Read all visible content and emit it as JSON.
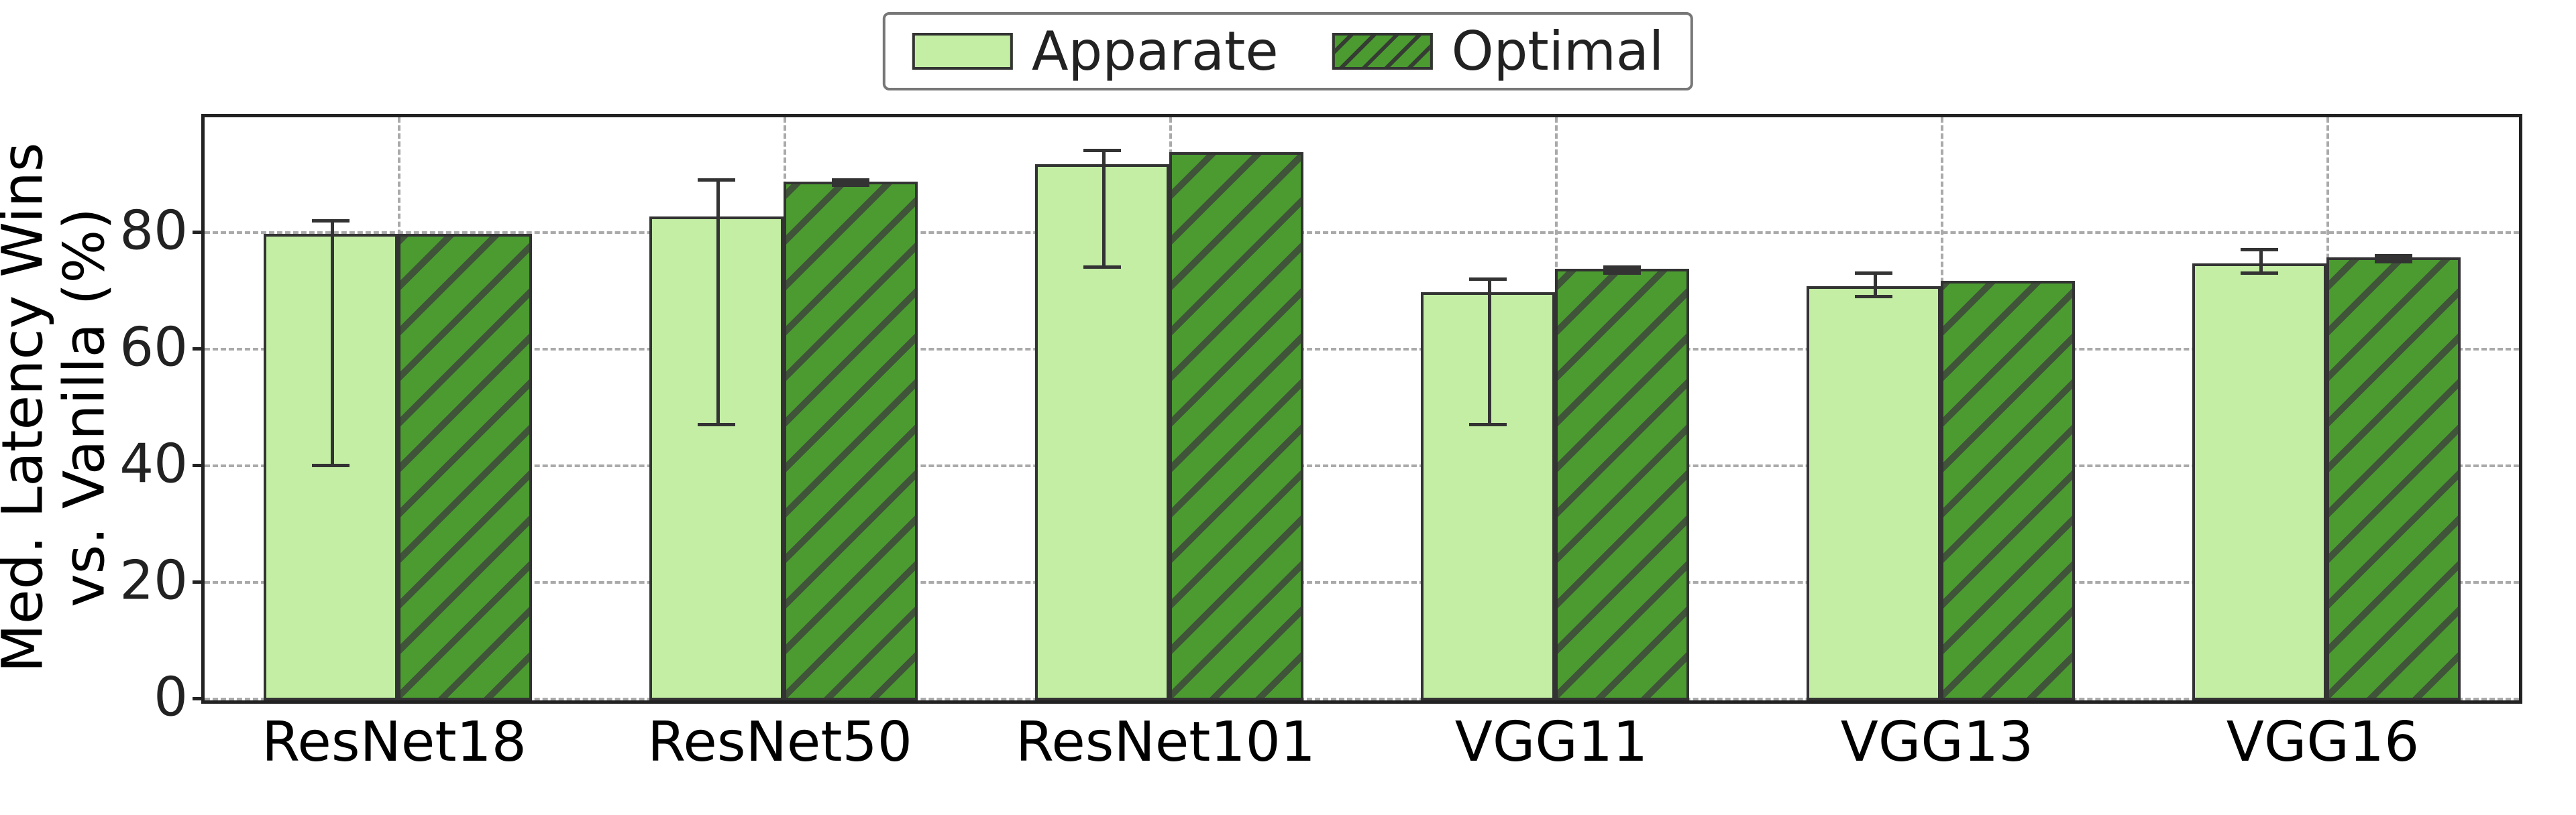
{
  "chart_data": {
    "type": "bar",
    "title": "",
    "xlabel": "",
    "ylabel": "Med. Latency Wins\nvs. Vanilla (%)",
    "ylim": [
      0,
      100
    ],
    "yticks": [
      0,
      20,
      40,
      60,
      80
    ],
    "categories": [
      "ResNet18",
      "ResNet50",
      "ResNet101",
      "VGG11",
      "VGG13",
      "VGG16"
    ],
    "series": [
      {
        "name": "Apparate",
        "color": "#c3eea4",
        "hatch": "",
        "values": [
          80,
          83,
          92,
          70,
          71,
          75
        ],
        "err_low": [
          40,
          47,
          74,
          47,
          69,
          73
        ],
        "err_high": [
          82,
          89,
          94,
          72,
          73,
          77
        ]
      },
      {
        "name": "Optimal",
        "color": "#4b9b31",
        "hatch": "//",
        "values": [
          80,
          89,
          94,
          74,
          72,
          76
        ],
        "err_low": [
          80,
          88,
          94,
          73,
          72,
          75
        ],
        "err_high": [
          80,
          89,
          94,
          74,
          72,
          76
        ]
      }
    ],
    "legend_position": "top-center"
  },
  "legend": {
    "apparate": "Apparate",
    "optimal": "Optimal"
  },
  "ylabel_line1": "Med. Latency Wins",
  "ylabel_line2": "vs. Vanilla (%)"
}
